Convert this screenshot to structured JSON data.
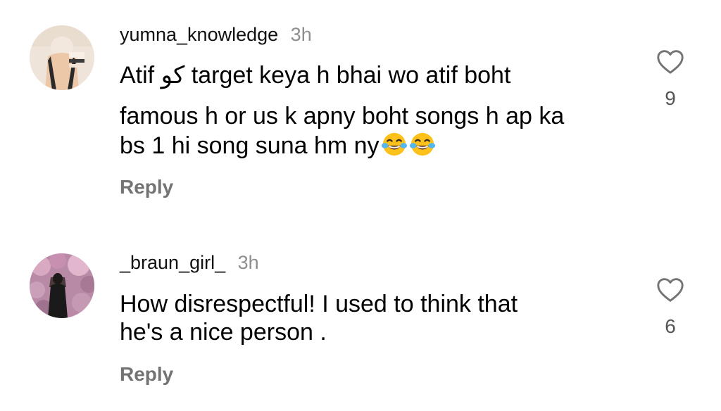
{
  "comments": [
    {
      "username": "yumna_knowledge",
      "time": "3h",
      "text_lines": [
        "Atif کو target keya h bhai wo atif boht",
        "famous h or us k apny boht songs h ap ka",
        "bs 1 hi song suna hm ny"
      ],
      "emojis": [
        "face-with-tears-of-joy-emoji",
        "face-with-tears-of-joy-emoji"
      ],
      "likes": "9",
      "reply_label": "Reply"
    },
    {
      "username": "_braun_girl_",
      "time": "3h",
      "text_lines": [
        "How disrespectful! I used to think that",
        "he's a nice person ."
      ],
      "likes": "6",
      "reply_label": "Reply"
    }
  ],
  "colors": {
    "text": "#000000",
    "secondary": "#8e8e8e",
    "reply": "#737373",
    "heart": "#737373"
  },
  "icons": {
    "like": "heart-outline-icon"
  }
}
